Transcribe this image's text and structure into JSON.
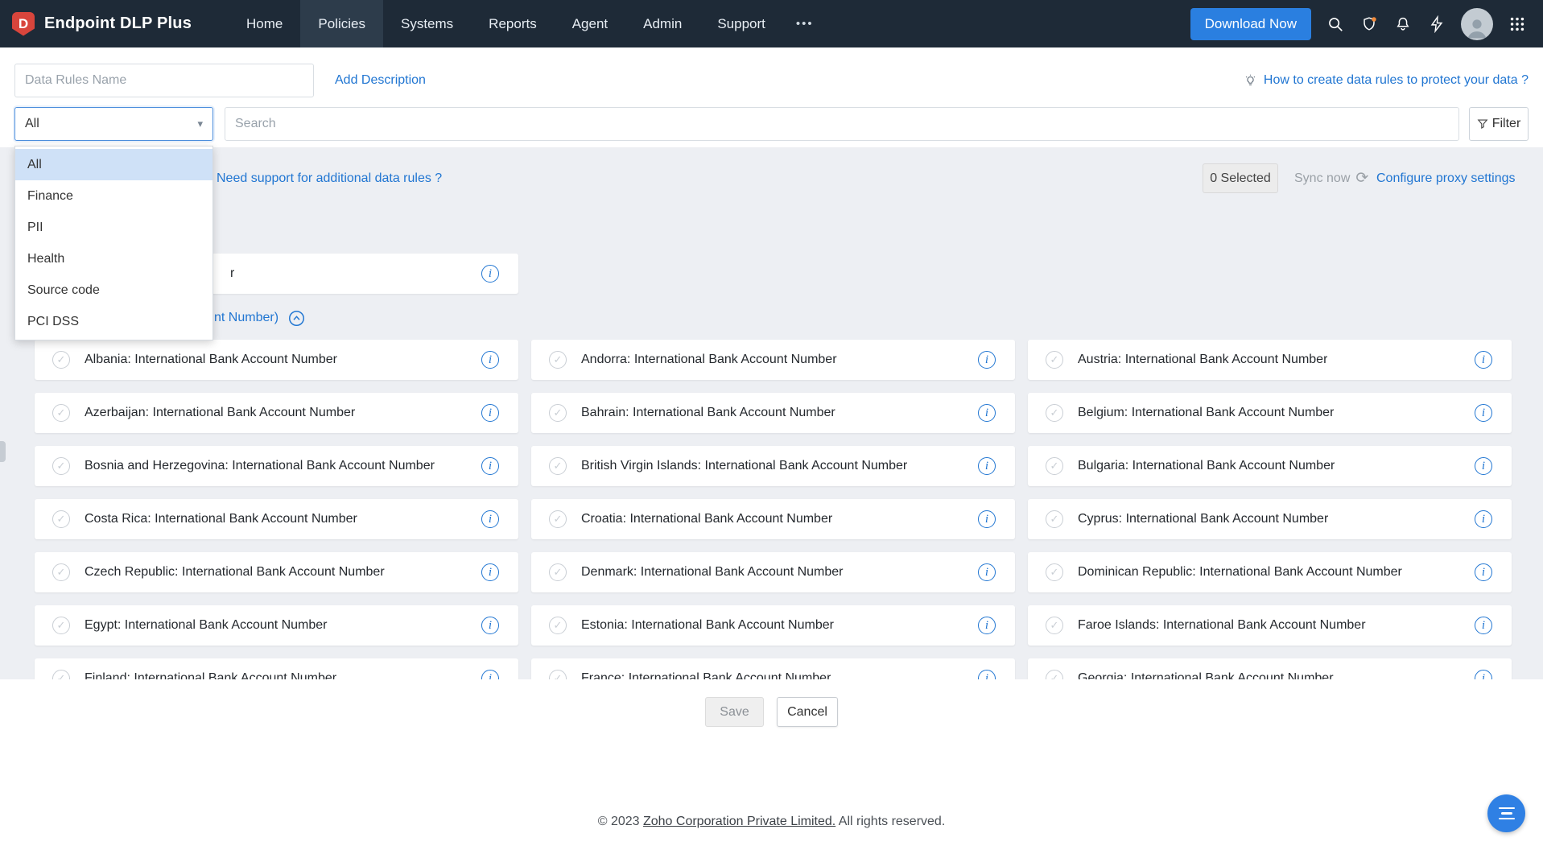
{
  "brand": {
    "name": "Endpoint DLP Plus"
  },
  "nav": {
    "items": [
      "Home",
      "Policies",
      "Systems",
      "Reports",
      "Agent",
      "Admin",
      "Support"
    ],
    "active": "Policies",
    "more": "•••"
  },
  "header_actions": {
    "download": "Download Now"
  },
  "toolbar": {
    "name_placeholder": "Data Rules Name",
    "add_description": "Add Description",
    "help_link": "How to create data rules to protect your data ?"
  },
  "filter_bar": {
    "selected": "All",
    "caret": "▾",
    "options": [
      "All",
      "Finance",
      "PII",
      "Health",
      "Source code",
      "PCI DSS"
    ],
    "search_placeholder": "Search",
    "filter_label": "Filter"
  },
  "actions_row": {
    "support_link": "Need support for additional data rules ?",
    "selected_count": "0 Selected",
    "sync_label": "Sync now",
    "sync_glyph": "⟳",
    "proxy_link": "Configure proxy settings"
  },
  "rules": {
    "partial_card_fragment": "r",
    "group_header_fragment": "nt Number)",
    "check_glyph": "✓",
    "info_glyph": "i",
    "cards": [
      "Albania: International Bank Account Number",
      "Andorra: International Bank Account Number",
      "Austria: International Bank Account Number",
      "Azerbaijan: International Bank Account Number",
      "Bahrain: International Bank Account Number",
      "Belgium: International Bank Account Number",
      "Bosnia and Herzegovina: International Bank Account Number",
      "British Virgin Islands: International Bank Account Number",
      "Bulgaria: International Bank Account Number",
      "Costa Rica: International Bank Account Number",
      "Croatia: International Bank Account Number",
      "Cyprus: International Bank Account Number",
      "Czech Republic: International Bank Account Number",
      "Denmark: International Bank Account Number",
      "Dominican Republic: International Bank Account Number",
      "Egypt: International Bank Account Number",
      "Estonia: International Bank Account Number",
      "Faroe Islands: International Bank Account Number"
    ],
    "clipped_cards": [
      "Finland: International Bank Account Number",
      "France: International Bank Account Number",
      "Georgia: International Bank Account Number"
    ]
  },
  "footer_buttons": {
    "save": "Save",
    "cancel": "Cancel"
  },
  "footer": {
    "copyright_prefix": "© 2023 ",
    "company_link": "Zoho Corporation Private Limited.",
    "rights": " All rights reserved."
  },
  "colors": {
    "accent": "#2176d2",
    "navbar": "#1e2a37",
    "option_highlight": "#cfe1f7"
  }
}
